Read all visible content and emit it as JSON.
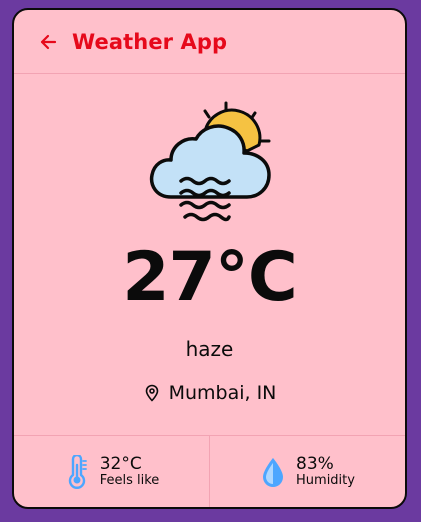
{
  "header": {
    "title": "Weather App",
    "back_icon": "arrow-left-icon"
  },
  "weather": {
    "icon": "haze-cloud-sun-icon",
    "temperature": "27°C",
    "condition": "haze",
    "location": "Mumbai, IN",
    "location_icon": "map-pin-icon"
  },
  "stats": {
    "feels_like": {
      "value": "32°C",
      "label": "Feels like",
      "icon": "thermometer-icon"
    },
    "humidity": {
      "value": "83%",
      "label": "Humidity",
      "icon": "water-drop-icon"
    }
  },
  "colors": {
    "background": "#6b3aa0",
    "card": "#ffc0cb",
    "accent": "#e6091b",
    "icon_blue": "#4da6ff",
    "sun": "#f5c242"
  }
}
